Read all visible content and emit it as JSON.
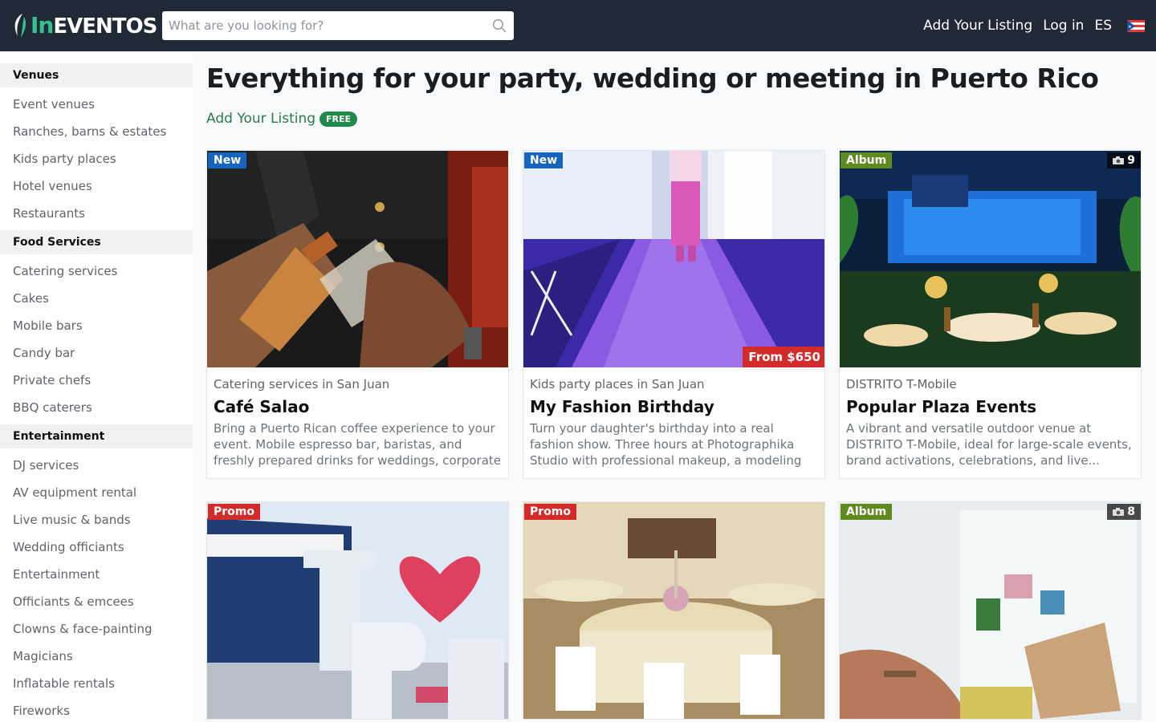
{
  "header": {
    "logo_prefix": "In",
    "logo_suffix": "Eventos",
    "search_placeholder": "What are you looking for?",
    "add_listing": "Add Your Listing",
    "login": "Log in",
    "language": "ES",
    "accent_color": "#35c08f",
    "bg_color": "#1f2a36"
  },
  "sidebar": {
    "groups": [
      {
        "heading": "Venues",
        "items": [
          "Event venues",
          "Ranches, barns & estates",
          "Kids party places",
          "Hotel venues",
          "Restaurants"
        ]
      },
      {
        "heading": "Food Services",
        "items": [
          "Catering services",
          "Cakes",
          "Mobile bars",
          "Candy bar",
          "Private chefs",
          "BBQ caterers"
        ]
      },
      {
        "heading": "Entertainment",
        "items": [
          "DJ services",
          "AV equipment rental",
          "Live music & bands",
          "Wedding officiants",
          "Entertainment",
          "Officiants & emcees",
          "Clowns & face-painting",
          "Magicians",
          "Inflatable rentals",
          "Fireworks"
        ]
      }
    ]
  },
  "main": {
    "title": "Everything for your party, wedding or meeting in Puerto Rico",
    "add_listing": "Add Your Listing",
    "free_badge": "FREE"
  },
  "cards": [
    {
      "badge": "New",
      "subtitle": "Catering services in San Juan",
      "title": "Café Salao",
      "description": "Bring a Puerto Rican coffee experience to your event. Mobile espresso bar, baristas, and freshly prepared drinks for weddings, corporate events,..."
    },
    {
      "badge": "New",
      "price": "From $650",
      "subtitle": "Kids party places in San Juan",
      "title": "My Fashion Birthday",
      "description": "Turn your daughter's birthday into a real fashion show. Three hours at Photographika Studio with professional makeup, a modeling class with an..."
    },
    {
      "badge": "Album",
      "photo_count": "9",
      "subtitle": "DISTRITO T-Mobile",
      "title": "Popular Plaza Events",
      "description": "A vibrant and versatile outdoor venue at DISTRITO T-Mobile, ideal for large-scale events, brand activations, celebrations, and live..."
    },
    {
      "badge": "Promo"
    },
    {
      "badge": "Promo"
    },
    {
      "badge": "Album",
      "photo_count": "8"
    }
  ]
}
